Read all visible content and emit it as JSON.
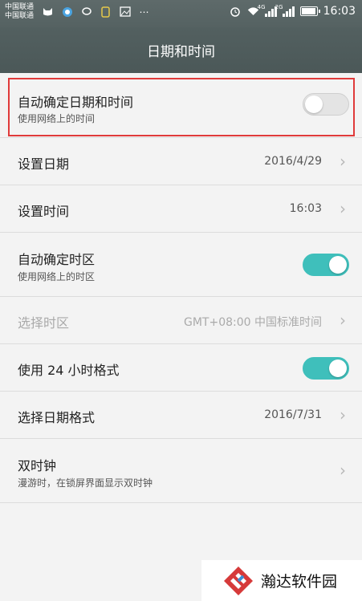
{
  "status_bar": {
    "carrier_1": "中国联通",
    "carrier_2": "中国联通",
    "clock": "16:03",
    "net1": "4G",
    "net2": "2G",
    "icons": [
      "cat-icon",
      "browser-icon",
      "chat-icon",
      "shield-icon",
      "image-icon",
      "more-dots-icon",
      "alarm-icon",
      "wifi-icon",
      "signal-icon",
      "signal-icon",
      "battery-icon"
    ]
  },
  "header": {
    "title": "日期和时间"
  },
  "settings": {
    "auto_datetime": {
      "label": "自动确定日期和时间",
      "sub": "使用网络上的时间",
      "toggle": "off"
    },
    "set_date": {
      "label": "设置日期",
      "value": "2016/4/29"
    },
    "set_time": {
      "label": "设置时间",
      "value": "16:03"
    },
    "auto_timezone": {
      "label": "自动确定时区",
      "sub": "使用网络上的时区",
      "toggle": "on"
    },
    "select_timezone": {
      "label": "选择时区",
      "value": "GMT+08:00 中国标准时间"
    },
    "use_24h": {
      "label": "使用 24 小时格式",
      "toggle": "on"
    },
    "date_format": {
      "label": "选择日期格式",
      "value": "2016/7/31"
    },
    "dual_clock": {
      "label": "双时钟",
      "sub": "漫游时，在锁屏界面显示双时钟"
    }
  },
  "watermark": {
    "text": "瀚达软件园"
  },
  "colors": {
    "accent": "#3fbfbb",
    "highlight": "#e03a3a",
    "header": "#4f5c5c"
  }
}
